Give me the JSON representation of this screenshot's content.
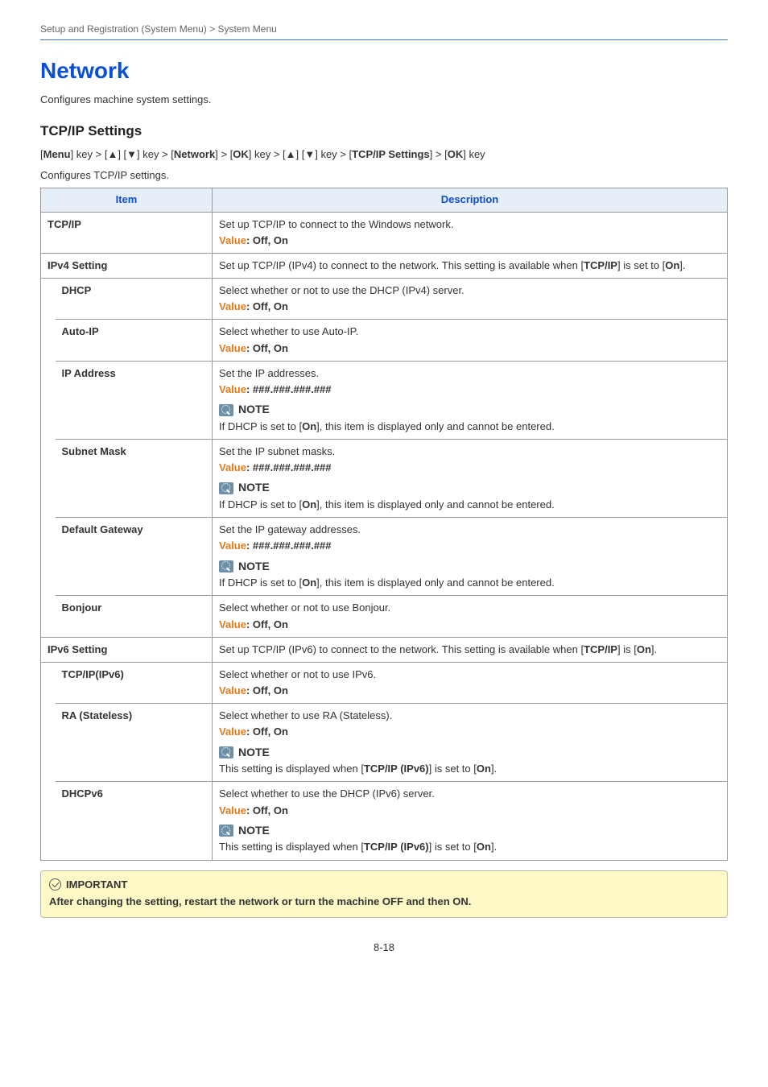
{
  "breadcrumb": "Setup and Registration (System Menu) > System Menu",
  "title": "Network",
  "intro": "Configures machine system settings.",
  "section": {
    "heading": "TCP/IP Settings",
    "nav_parts": [
      "[",
      "Menu",
      "] key > [▲] [▼] key > [",
      "Network",
      "] > [",
      "OK",
      "] key > [▲] [▼] key > [",
      "TCP/IP Settings",
      "] > [",
      "OK",
      "] key"
    ],
    "sub_intro": "Configures TCP/IP settings."
  },
  "th_item": "Item",
  "th_desc": "Description",
  "note_label": "NOTE",
  "rows": {
    "tcpip": {
      "label": "TCP/IP",
      "desc": "Set up TCP/IP to connect to the Windows network.",
      "value_prefix": "Value",
      "value_text": ": Off, On"
    },
    "ipv4": {
      "label": "IPv4 Setting",
      "desc_pre": "Set up TCP/IP (IPv4) to connect to the network. This setting is available when [",
      "desc_b1": "TCP/IP",
      "desc_mid": "] is set to [",
      "desc_b2": "On",
      "desc_post": "]."
    },
    "dhcp": {
      "label": "DHCP",
      "desc": "Select whether or not to use the DHCP (IPv4) server.",
      "value_prefix": "Value",
      "value_text": ": Off, On"
    },
    "autoip": {
      "label": "Auto-IP",
      "desc": "Select whether to use Auto-IP.",
      "value_prefix": "Value",
      "value_text": ": Off, On"
    },
    "ipaddr": {
      "label": "IP Address",
      "desc": "Set the IP addresses.",
      "value_prefix": "Value",
      "value_text": ": ###.###.###.###",
      "note_pre": "If DHCP is set to [",
      "note_b": "On",
      "note_post": "], this item is displayed only and cannot be entered."
    },
    "subnet": {
      "label": "Subnet Mask",
      "desc": "Set the IP subnet masks.",
      "value_prefix": "Value",
      "value_text": ": ###.###.###.###",
      "note_pre": "If DHCP is set to [",
      "note_b": "On",
      "note_post": "], this item is displayed only and cannot be entered."
    },
    "gateway": {
      "label": "Default Gateway",
      "desc": "Set the IP gateway addresses.",
      "value_prefix": "Value",
      "value_text": ": ###.###.###.###",
      "note_pre": "If DHCP is set to [",
      "note_b": "On",
      "note_post": "], this item is displayed only and cannot be entered."
    },
    "bonjour": {
      "label": "Bonjour",
      "desc": "Select whether or not to use Bonjour.",
      "value_prefix": "Value",
      "value_text": ": Off, On"
    },
    "ipv6": {
      "label": "IPv6 Setting",
      "desc_pre": "Set up TCP/IP (IPv6) to connect to the network. This setting is available when [",
      "desc_b1": "TCP/IP",
      "desc_mid": "] is [",
      "desc_b2": "On",
      "desc_post": "]."
    },
    "tcpipv6": {
      "label": "TCP/IP(IPv6)",
      "desc": "Select whether or not to use IPv6.",
      "value_prefix": "Value",
      "value_text": ": Off, On"
    },
    "ra": {
      "label": "RA (Stateless)",
      "desc": "Select whether to use RA (Stateless).",
      "value_prefix": "Value",
      "value_text": ": Off, On",
      "note_pre": "This setting is displayed when [",
      "note_b": "TCP/IP (IPv6)",
      "note_mid": "] is set to [",
      "note_b2": "On",
      "note_post": "]."
    },
    "dhcpv6": {
      "label": "DHCPv6",
      "desc": "Select whether to use the DHCP (IPv6) server.",
      "value_prefix": "Value",
      "value_text": ": Off, On",
      "note_pre": "This setting is displayed when [",
      "note_b": "TCP/IP (IPv6)",
      "note_mid": "] is set to [",
      "note_b2": "On",
      "note_post": "]."
    }
  },
  "important": {
    "label": "IMPORTANT",
    "text": "After changing the setting, restart the network or turn the machine OFF and then ON."
  },
  "page_num": "8-18"
}
